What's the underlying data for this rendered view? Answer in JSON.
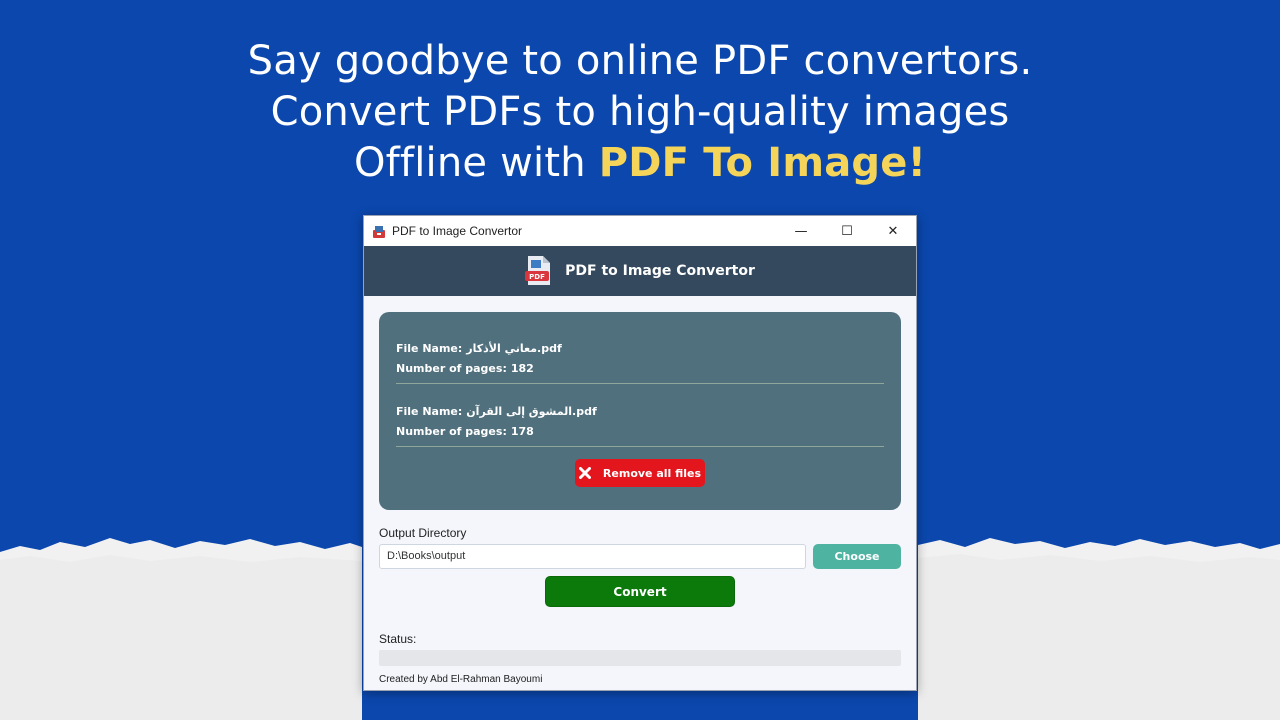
{
  "headline": {
    "line1": "Say goodbye to online PDF convertors.",
    "line2": "Convert PDFs to high-quality images",
    "line3_prefix": "Offline with",
    "line3_highlight": "PDF To Image!"
  },
  "colors": {
    "background": "#0b47ad",
    "highlight": "#f5d45a",
    "header": "#34495e",
    "file_box": "#50707e",
    "remove_button": "#e3161e",
    "choose_button": "#4fb3a2",
    "convert_button": "#0b7a0b"
  },
  "window": {
    "title": "PDF to Image Convertor",
    "icon": "pdf-app-icon",
    "controls": {
      "minimize": "—",
      "maximize": "☐",
      "close": "✕"
    }
  },
  "header": {
    "title": "PDF to Image Convertor",
    "icon": "pdf-file-icon"
  },
  "files": [
    {
      "name_label": "File Name:",
      "name": "معاني الأذكار.pdf",
      "pages_label": "Number of pages:",
      "pages": "182"
    },
    {
      "name_label": "File Name:",
      "name": "المشوق إلى القرآن.pdf",
      "pages_label": "Number of pages:",
      "pages": "178"
    }
  ],
  "remove_button": {
    "label": "Remove all files",
    "icon": "x-icon"
  },
  "output": {
    "label": "Output Directory",
    "value": "D:\\Books\\output",
    "choose_label": "Choose"
  },
  "convert_label": "Convert",
  "status": {
    "label": "Status:",
    "progress": 0
  },
  "credit": "Created by Abd El-Rahman Bayoumi"
}
